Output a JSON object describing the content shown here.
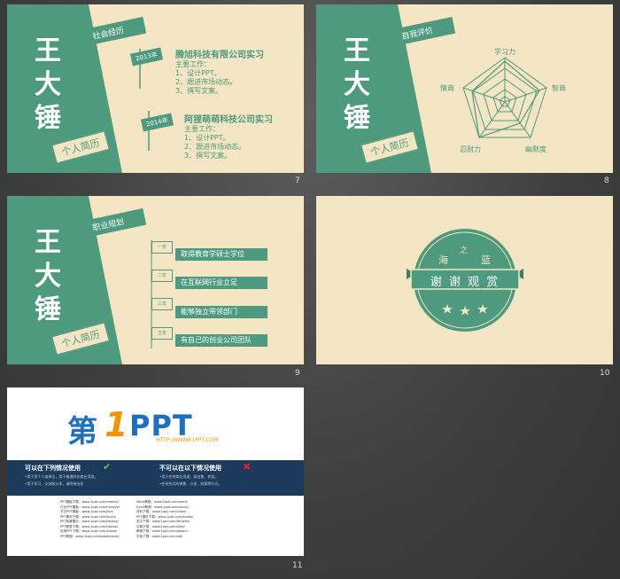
{
  "slide7": {
    "number": "7",
    "name": [
      "王",
      "大",
      "锤"
    ],
    "tag": "个人简历",
    "flag": "社会经历",
    "entries": [
      {
        "year": "2013年",
        "company": "腾旭科技有限公司实习",
        "label": "主要工作：",
        "items": [
          "1、设计PPT。",
          "2、跟进市场动态。",
          "3、撰写文案。"
        ]
      },
      {
        "year": "2014年",
        "company": "阿狸萌萌科技公司实习",
        "label": "主要工作：",
        "items": [
          "1、设计PPT。",
          "2、跟进市场动态。",
          "3、撰写文案。"
        ]
      }
    ]
  },
  "slide8": {
    "number": "8",
    "name": [
      "王",
      "大",
      "锤"
    ],
    "tag": "个人简历",
    "flag": "自我评价",
    "radar_labels": [
      "学习力",
      "智商",
      "幽默度",
      "忍耐力",
      "情商"
    ]
  },
  "slide9": {
    "number": "9",
    "name": [
      "王",
      "大",
      "锤"
    ],
    "tag": "个人简历",
    "flag": "职业规划",
    "plans": [
      {
        "year": "一年",
        "text": "取得教育学硕士学位"
      },
      {
        "year": "二年",
        "text": "在互联网行业立足"
      },
      {
        "year": "三年",
        "text": "能够独立带领部门"
      },
      {
        "year": "五年",
        "text": "有自己的创业公司团队"
      }
    ]
  },
  "slide10": {
    "number": "10",
    "seal_top": [
      "海",
      "之",
      "蓝"
    ],
    "seal_band": "谢 谢 观 赏"
  },
  "slide11": {
    "number": "11",
    "logo_main": "第",
    "logo_one": "1",
    "logo_ppt": "PPT",
    "logo_url": "HTTP://WWW.1PPT.COM",
    "can_title": "可以在下列情况使用",
    "can_lines": [
      "•用于您个人或单位，用于普通的非商业用途。",
      "•用于学习、交流和分享，请附带出处"
    ],
    "cannot_title": "不可以在以下情况使用",
    "cannot_lines": [
      "•用于任何商业用途，如出售、转卖。",
      "•任何形式的销售、分发、转载等行为。"
    ],
    "links_left": [
      "PPT模板下载：www.1ppt.com/moban/",
      "行业PPT模板：www.1ppt.com/hangye/",
      "节日PPT模板：www.1ppt.com/jieri/",
      "PPT素材下载：www.1ppt.com/sucai/",
      "PPT背景图片：www.1ppt.com/beijing/",
      "PPT图表下载：www.1ppt.com/tubiao/",
      "优秀PPT下载：www.1ppt.com/xiazai/",
      "PPT教程：www.1ppt.com/powerpoint/"
    ],
    "links_right": [
      "Word教程：www.1ppt.com/word/",
      "Excel教程：www.1ppt.com/excel/",
      "资料下载：www.1ppt.com/ziliao/",
      "PPT课件下载：www.1ppt.com/kejian/",
      "范文下载：www.1ppt.com/fanwen/",
      "试卷下载：www.1ppt.com/shiti/",
      "教案下载：www.1ppt.com/jiaoan/",
      "字体下载：www.1ppt.com/ziti/"
    ]
  },
  "colors": {
    "green": "#4e9a7f",
    "cream": "#f4e6c4",
    "navy": "#1b3a5c",
    "orange": "#f29400",
    "blue": "#1e6fbf"
  }
}
